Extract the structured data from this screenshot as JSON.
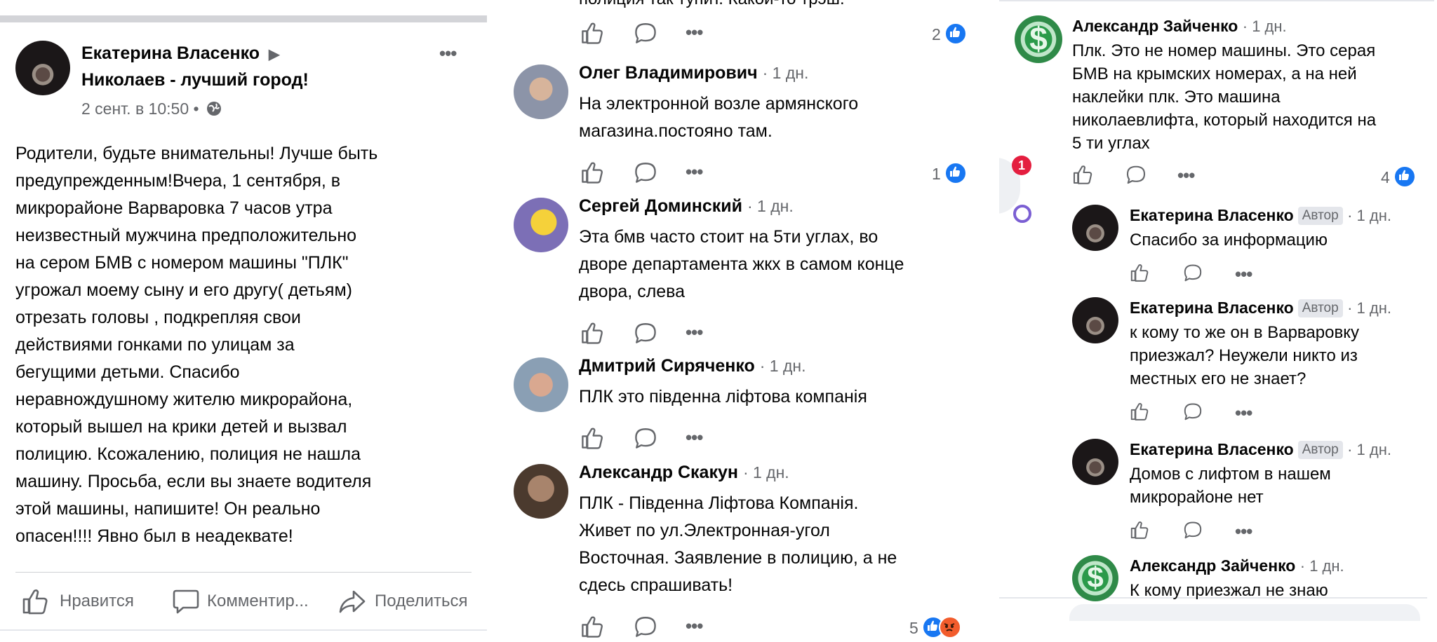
{
  "post": {
    "author": "Екатерина Власенко",
    "arrow": "▶",
    "group": "Николаев - лучший город!",
    "time": "2 сент. в 10:50 •",
    "text_lines": [
      "Родители, будьте внимательны! Лучше быть",
      "предупрежденным!Вчера, 1 сентября, в",
      "микрорайоне Варваровка 7 часов утра",
      "неизвестный мужчина предположительно",
      "на сером БМВ с номером машины \"ПЛК\"",
      "угрожал  моему сыну и его другу( детьям)",
      "отрезать головы , подкрепляя свои",
      "действиями гонками по улицам за",
      "бегущими детьми. Спасибо",
      "неравнождушному жителю микрорайона,",
      "который вышел на крики детей и вызвал",
      "полицию. Ксожалению, полиция не нашла",
      "машину. Просьба, если вы знаете водителя",
      "этой машины, напишите! Он реально",
      "опасен!!!! Явно был в неадеквате!"
    ],
    "actions": {
      "like": "Нравится",
      "comment": "Комментир...",
      "share": "Поделиться"
    },
    "more": "•••"
  },
  "middle": {
    "top_partial": "полиция так тупит. Какой-то трэш.",
    "top_count": "2",
    "comments": [
      {
        "name": "Олег Владимирович",
        "time": "· 1 дн.",
        "lines": [
          "На электронной возле армянского",
          "магазина.постояно там."
        ],
        "count": "1"
      },
      {
        "name": "Сергей Доминский",
        "time": "· 1 дн.",
        "lines": [
          "Эта бмв часто стоит на 5ти углах, во",
          "дворе департамента жкх в самом конце",
          "двора, слева"
        ],
        "count": ""
      },
      {
        "name": "Дмитрий Сиряченко",
        "time": "· 1 дн.",
        "lines": [
          "ПЛК это південна ліфтова компанія"
        ],
        "count": ""
      },
      {
        "name": "Александр Скакун",
        "time": "· 1 дн.",
        "lines": [
          "ПЛК - Південна Ліфтова Компанія.",
          "Живет по ул.Электронная-угол",
          "Восточная. Заявление в полицию, а не",
          "сдесь спрашивать!"
        ],
        "count": "5"
      }
    ]
  },
  "right": {
    "notif_count": "1",
    "main_comment": {
      "name": "Александр Зайченко",
      "time": "· 1 дн.",
      "lines": [
        "Плк. Это не номер машины.  Это серая",
        "БМВ на крымских номерах, а на ней",
        "наклейки плк. Это машина",
        "николаевлифта, который находится  на",
        "5 ти углах"
      ],
      "count": "4"
    },
    "replies": [
      {
        "name": "Екатерина Власенко",
        "badge": "Автор",
        "time": "· 1 дн.",
        "lines": [
          "Спасибо за информацию"
        ]
      },
      {
        "name": "Екатерина Власенко",
        "badge": "Автор",
        "time": "· 1 дн.",
        "lines": [
          "к кому то же он в Варваровку",
          "приезжал? Неужели никто из",
          "местных его не знает?"
        ]
      },
      {
        "name": "Екатерина Власенко",
        "badge": "Автор",
        "time": "· 1 дн.",
        "lines": [
          "Домов с лифтом  в нашем",
          "микрорайоне нет"
        ]
      },
      {
        "name": "Александр Зайченко",
        "badge": "",
        "time": "· 1 дн.",
        "lines": [
          "К кому приезжал не знаю"
        ]
      }
    ]
  },
  "icons": [
    "like-icon",
    "comment-icon",
    "share-icon",
    "globe-icon",
    "more-icon",
    "like-badge-icon",
    "angry-badge-icon",
    "notification-badge"
  ],
  "colors": {
    "brand": "#1877f2",
    "muted": "#65676b",
    "angry": "#f25c2c",
    "notif": "#e41e3f"
  }
}
